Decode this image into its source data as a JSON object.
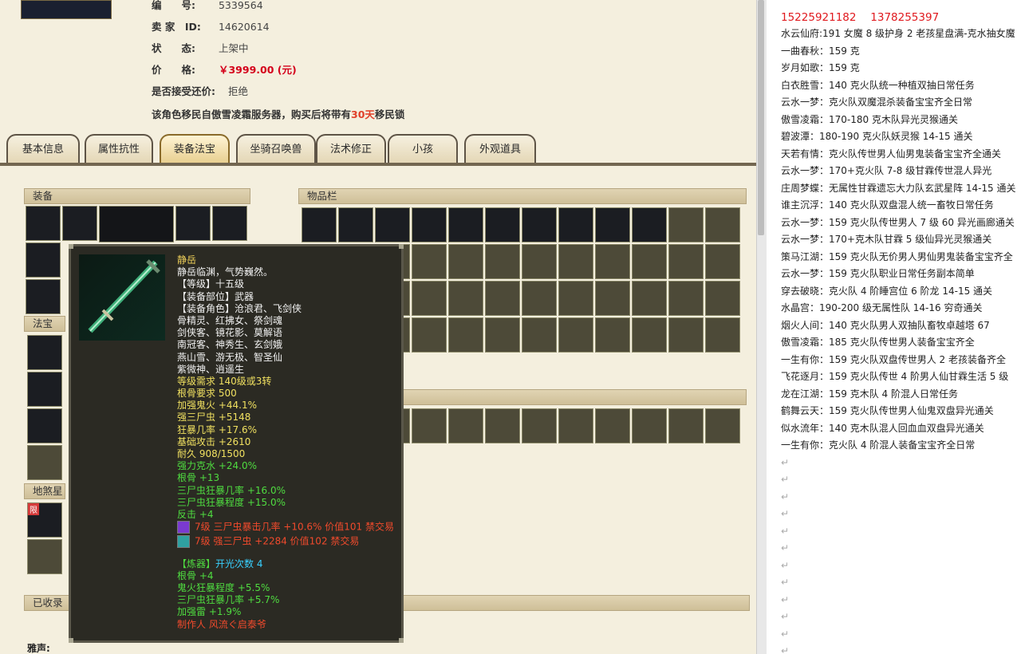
{
  "info": {
    "id_label": "编　　号:",
    "id_value": "5339564",
    "seller_label": "卖 家　ID:",
    "seller_value": "14620614",
    "status_label": "状　　态:",
    "status_value": "上架中",
    "price_label": "价　　格:",
    "price_value": "￥3999.00 (元)",
    "counter_label": "是否接受还价:",
    "counter_value": "拒绝",
    "notice_pre": "该角色移民自傲雪凌霜服务器，购买后将带有",
    "notice_days": "30天",
    "notice_post": "移民锁"
  },
  "tabs": [
    "基本信息",
    "属性抗性",
    "装备法宝",
    "坐骑召唤兽",
    "法术修正",
    "小孩",
    "外观道具"
  ],
  "active_tab": "装备法宝",
  "panels": {
    "equip": "装备",
    "inventory": "物品栏",
    "fabao": "法宝",
    "dishaxing": "地煞星",
    "collected": "已收录",
    "yasheng": "雅声:",
    "limit_badge": "限"
  },
  "tooltip": {
    "name": "静岳",
    "desc": "静岳临渊，气势巍然。",
    "level": "【等级】十五级",
    "part": "【装备部位】武器",
    "roles": [
      "【装备角色】沧浪君、飞剑侠",
      "骨精灵、红拂女、祭剑魂",
      "剑侠客、镜花影、莫解语",
      "南冠客、神秀生、玄剑娥",
      "燕山雪、游无极、智圣仙",
      "紫微神、逍遥生"
    ],
    "req_level": "等级需求 140级或3转",
    "req_bone": "根骨要求 500",
    "yellow_stats": [
      "加强鬼火 +44.1%",
      "强三尸虫 +5148",
      "狂暴几率 +17.6%",
      "基础攻击 +2610",
      "耐久 908/1500"
    ],
    "green_stats": [
      "强力克水 +24.0%",
      "根骨 +13",
      "三尸虫狂暴几率 +16.0%",
      "三尸虫狂暴程度 +15.0%",
      "反击 +4"
    ],
    "gems": [
      "7级 三尸虫暴击几率 +10.6% 价值101 禁交易",
      "7级 强三尸虫 +2284 价值102 禁交易"
    ],
    "refine_label": "【炼器】",
    "refine_count": "开光次数 4",
    "refine_stats": [
      "根骨 +4",
      "鬼火狂暴程度 +5.5%",
      "三尸虫狂暴几率 +5.7%",
      "加强雷 +1.9%"
    ],
    "maker": "制作人 风流ぐ启泰爷"
  },
  "notes": {
    "phones": "15225921182　 1378255397",
    "lines": [
      "水云仙府:191 女魔 8 级护身 2 老孩星盘满-克水抽女魔",
      "一曲春秋：159 克",
      "岁月如歌：159 克",
      "白衣胜雪：140 克火队统一种植双抽日常任务",
      "云水一梦：克火队双魔混杀装备宝宝齐全日常",
      "傲雪凌霜：170-180 克木队异光灵猴通关",
      "碧波潭：180-190 克火队妖灵猴 14-15 通关",
      "天若有情：克火队传世男人仙男鬼装备宝宝齐全通关",
      "云水一梦：170+克火队 7-8 级甘霖传世混人异光",
      "庄周梦蝶：无属性甘霖遗忘大力队玄武星阵 14-15 通关",
      "谁主沉浮：140 克火队双盘混人统一畜牧日常任务",
      "云水一梦：159 克火队传世男人 7 级 60 异光画廊通关",
      "云水一梦：170+克木队甘霖 5 级仙异光灵猴通关",
      "策马江湖：159 克火队无价男人男仙男鬼装备宝宝齐全",
      "云水一梦：159 克火队职业日常任务副本简单",
      "穿去破晓：克火队 4 阶睡宫位 6 阶龙 14-15 通关",
      "水晶宫：190-200 级无属性队 14-16 穷奇通关",
      "烟火人间：140 克火队男人双抽队畜牧卓越塔 67",
      "傲雪凌霜：185 克火队传世男人装备宝宝齐全",
      "一生有你：159 克火队双盘传世男人 2 老孩装备齐全",
      "飞花逐月：159 克火队传世 4 阶男人仙甘霖生活 5 级",
      "龙在江湖：159 克木队 4 阶混人日常任务",
      "鹤舞云天：159 克火队传世男人仙鬼双盘异光通关",
      "似水流年：140 克木队混人回血血双盘异光通关",
      "一生有你：克火队 4 阶混人装备宝宝齐全日常"
    ],
    "para_mark": "↵"
  }
}
